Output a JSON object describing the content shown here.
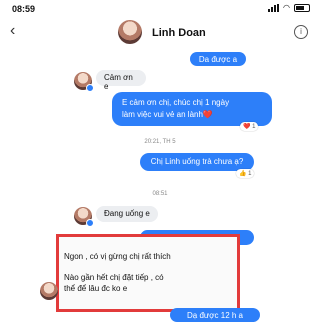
{
  "status": {
    "time": "08:59"
  },
  "header": {
    "back": "‹",
    "name": "Linh Doan",
    "info": "i"
  },
  "messages": {
    "out1": "Da được a",
    "in1": "Cảm ơn e",
    "out2_line1": "E cảm ơn chị, chúc chị 1 ngày",
    "out2_line2": "làm việc vui vẻ an lành❤️",
    "reaction1": "❤️ 1",
    "ts1": "20:21, TH 5",
    "out3": "Chị Linh uống trà chưa ạ?",
    "reaction2": "👍 1",
    "ts2": "08:51",
    "in2": "Đang uống e",
    "out4_partial": "Dạ dùng hợp vị chị ko ạ",
    "quote1": "Ngon , có vị gừng chị rất thích",
    "quote2_line1": "Nào gần hết chị đặt tiếp , có",
    "quote2_line2": "thể để lâu đc ko e",
    "out5_partial": "Dạ được 12 h a"
  },
  "colors": {
    "accent": "#2d7ff9",
    "highlight": "#e23b3b",
    "incoming": "#eceef1"
  }
}
